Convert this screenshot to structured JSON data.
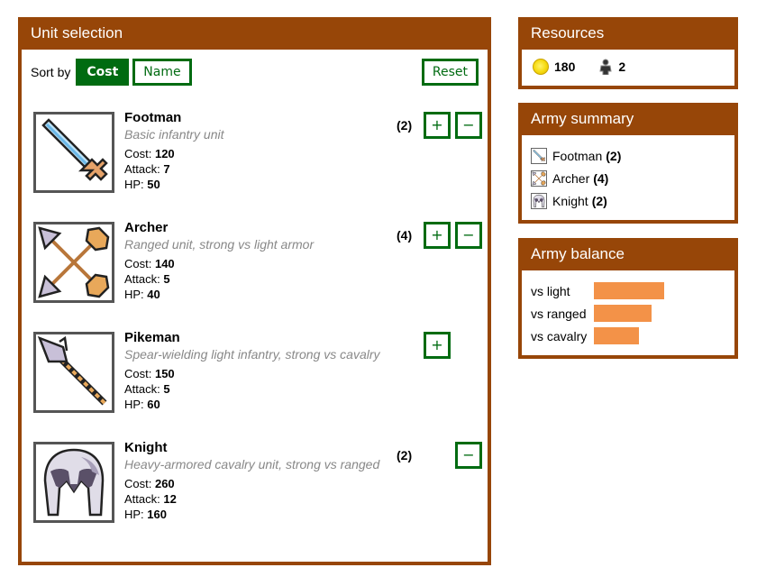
{
  "unit_selection": {
    "title": "Unit selection",
    "sort_label": "Sort by",
    "sort_options": [
      {
        "label": "Cost",
        "active": true
      },
      {
        "label": "Name",
        "active": false
      }
    ],
    "reset_label": "Reset",
    "plus_label": "+",
    "minus_label": "−",
    "units": [
      {
        "name": "Footman",
        "description": "Basic infantry unit",
        "cost_label": "Cost:",
        "cost": "120",
        "attack_label": "Attack:",
        "attack": "7",
        "hp_label": "HP:",
        "hp": "50",
        "count": "(2)",
        "icon": "sword-icon",
        "can_add": true,
        "can_remove": true
      },
      {
        "name": "Archer",
        "description": "Ranged unit, strong vs light armor",
        "cost_label": "Cost:",
        "cost": "140",
        "attack_label": "Attack:",
        "attack": "5",
        "hp_label": "HP:",
        "hp": "40",
        "count": "(4)",
        "icon": "crossed-arrows-icon",
        "can_add": true,
        "can_remove": true
      },
      {
        "name": "Pikeman",
        "description": "Spear-wielding light infantry, strong vs cavalry",
        "cost_label": "Cost:",
        "cost": "150",
        "attack_label": "Attack:",
        "attack": "5",
        "hp_label": "HP:",
        "hp": "60",
        "count": "",
        "icon": "spear-icon",
        "can_add": true,
        "can_remove": false
      },
      {
        "name": "Knight",
        "description": "Heavy-armored cavalry unit, strong vs ranged",
        "cost_label": "Cost:",
        "cost": "260",
        "attack_label": "Attack:",
        "attack": "12",
        "hp_label": "HP:",
        "hp": "160",
        "count": "(2)",
        "icon": "helmet-icon",
        "can_add": false,
        "can_remove": true
      }
    ]
  },
  "resources": {
    "title": "Resources",
    "gold": "180",
    "gold_icon": "gold-coin-icon",
    "population": "2",
    "population_icon": "population-icon"
  },
  "army_summary": {
    "title": "Army summary",
    "items": [
      {
        "name": "Footman",
        "count": "(2)",
        "icon": "sword-icon"
      },
      {
        "name": "Archer",
        "count": "(4)",
        "icon": "crossed-arrows-icon"
      },
      {
        "name": "Knight",
        "count": "(2)",
        "icon": "helmet-icon"
      }
    ]
  },
  "army_balance": {
    "title": "Army balance",
    "bar_color": "#f39248",
    "rows": [
      {
        "label": "vs light",
        "value": 0.78
      },
      {
        "label": "vs ranged",
        "value": 0.64
      },
      {
        "label": "vs cavalry",
        "value": 0.5
      }
    ]
  },
  "colors": {
    "panel_brown": "#974608",
    "button_green": "#006b11",
    "description_gray": "#888888"
  }
}
